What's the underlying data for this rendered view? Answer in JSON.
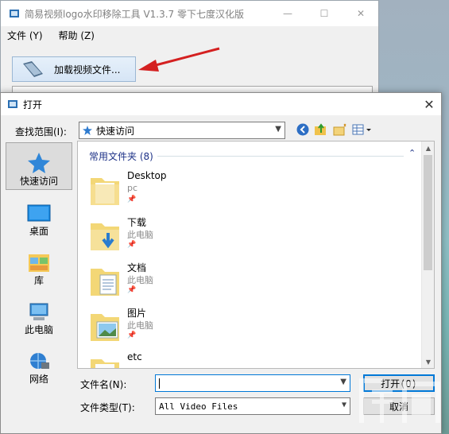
{
  "app": {
    "title": "简易视频logo水印移除工具 V1.3.7 零下七度汉化版",
    "menu": [
      "文件 (Y)",
      "帮助 (Z)"
    ],
    "minimize": "—",
    "maximize": "☐",
    "close": "✕",
    "load_button": "加载视频文件..."
  },
  "dialog": {
    "title": "打开",
    "close": "✕",
    "look_in_label": "查找范围(I):",
    "look_in_value": "快速访问",
    "places": [
      "快速访问",
      "桌面",
      "库",
      "此电脑",
      "网络"
    ],
    "group_header": "常用文件夹 (8)",
    "items": [
      {
        "name": "Desktop",
        "sub": "pc"
      },
      {
        "name": "下载",
        "sub": "此电脑"
      },
      {
        "name": "文档",
        "sub": "此电脑"
      },
      {
        "name": "图片",
        "sub": "此电脑"
      },
      {
        "name": "etc",
        "sub": ""
      }
    ],
    "filename_label": "文件名(N):",
    "filename_value": "",
    "filetype_label": "文件类型(T):",
    "filetype_value": "All Video Files",
    "open_button": "打开(O)",
    "cancel_button": "取消"
  },
  "colors": {
    "accent": "#0078d7",
    "group_header": "#1e3287",
    "arrow": "#d42020",
    "folder": "#f5d776"
  }
}
